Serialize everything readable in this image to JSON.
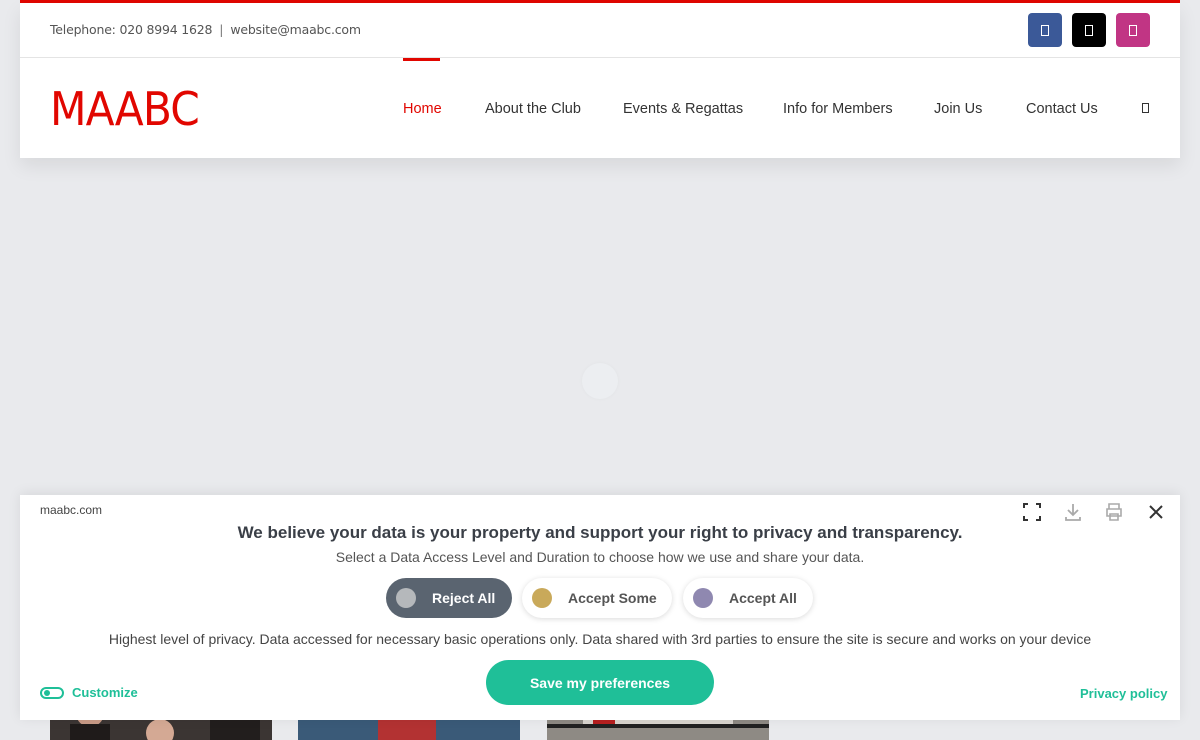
{
  "topbar": {
    "telephone": "Telephone: 020 8994 1628",
    "separator": "|",
    "email": "website@maabc.com"
  },
  "social": [
    {
      "name": "facebook-icon",
      "color": "#3b5998"
    },
    {
      "name": "x-icon",
      "color": "#000000"
    },
    {
      "name": "instagram-icon",
      "color": "#c13584"
    }
  ],
  "logo": "MAABC",
  "nav": {
    "items": [
      "Home",
      "About the Club",
      "Events & Regattas",
      "Info for Members",
      "Join Us",
      "Contact Us"
    ],
    "active": "Home"
  },
  "consent": {
    "site": "maabc.com",
    "title": "We believe your data is your property and support your right to privacy and transparency.",
    "subtitle": "Select a Data Access Level and Duration to choose how we use and share your data.",
    "options": [
      {
        "label": "Reject All",
        "dot_color": "#b5b8bb",
        "selected": true
      },
      {
        "label": "Accept Some",
        "dot_color": "#c9a95a",
        "selected": false
      },
      {
        "label": "Accept All",
        "dot_color": "#8f88b0",
        "selected": false
      }
    ],
    "description": "Highest level of privacy. Data accessed for necessary basic operations only. Data shared with 3rd parties to ensure the site is secure and works on your device",
    "save_label": "Save my preferences",
    "customize_label": "Customize",
    "privacy_label": "Privacy policy"
  },
  "colors": {
    "brand_red": "#e10600",
    "consent_accent": "#1fbf98"
  }
}
